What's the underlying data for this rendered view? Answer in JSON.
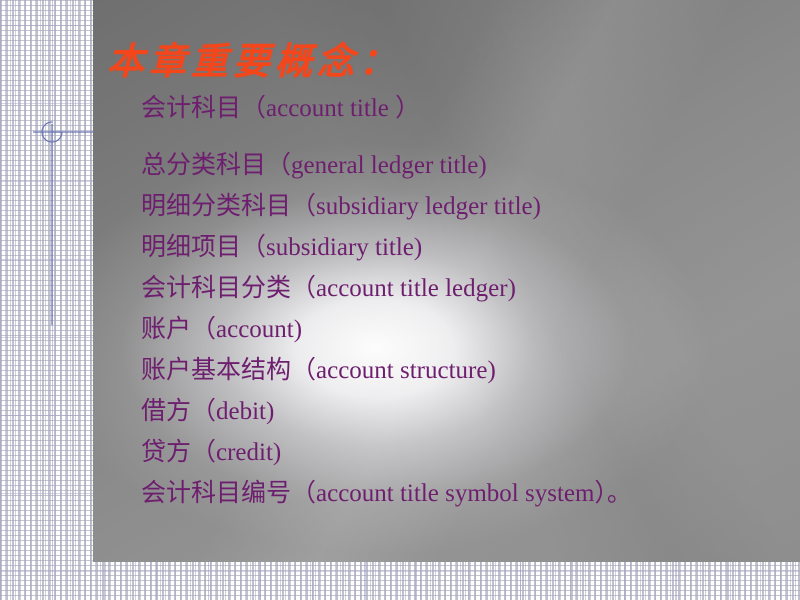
{
  "slide": {
    "title": "本章重要概念：",
    "title_color": "#F4461B",
    "body_color": "#6E1E6E",
    "panel_gray": "#8A8A8A",
    "grid_line_color": "#9A9BC8",
    "drafting_line_color": "#6A74B4"
  },
  "concepts": [
    {
      "cn": "会计科目",
      "en": "（account  title ）",
      "full": "会计科目（account  title ）"
    },
    {
      "cn": "总分类科目",
      "en": "（general ledger title)",
      "full": "总分类科目（general ledger title)"
    },
    {
      "cn": "明细分类科目",
      "en": "（subsidiary  ledger title)",
      "full": "明细分类科目（subsidiary  ledger title)"
    },
    {
      "cn": "明细项目",
      "en": "（subsidiary  title)",
      "full": "明细项目（subsidiary  title)"
    },
    {
      "cn": "会计科目分类",
      "en": "（account title ledger)",
      "full": "会计科目分类（account title ledger)"
    },
    {
      "cn": "账户",
      "en": "（account)",
      "full": "账户（account)"
    },
    {
      "cn": "账户基本结构",
      "en": "（account structure)",
      "full": "账户基本结构（account structure)"
    },
    {
      "cn": "借方",
      "en": "（debit)",
      "full": "借方（debit)"
    },
    {
      "cn": "贷方",
      "en": "（credit)",
      "full": "贷方（credit)"
    },
    {
      "cn": "会计科目编号",
      "en": "（account  title  symbol system）。",
      "full": "会计科目编号（account  title  symbol system）。"
    }
  ]
}
